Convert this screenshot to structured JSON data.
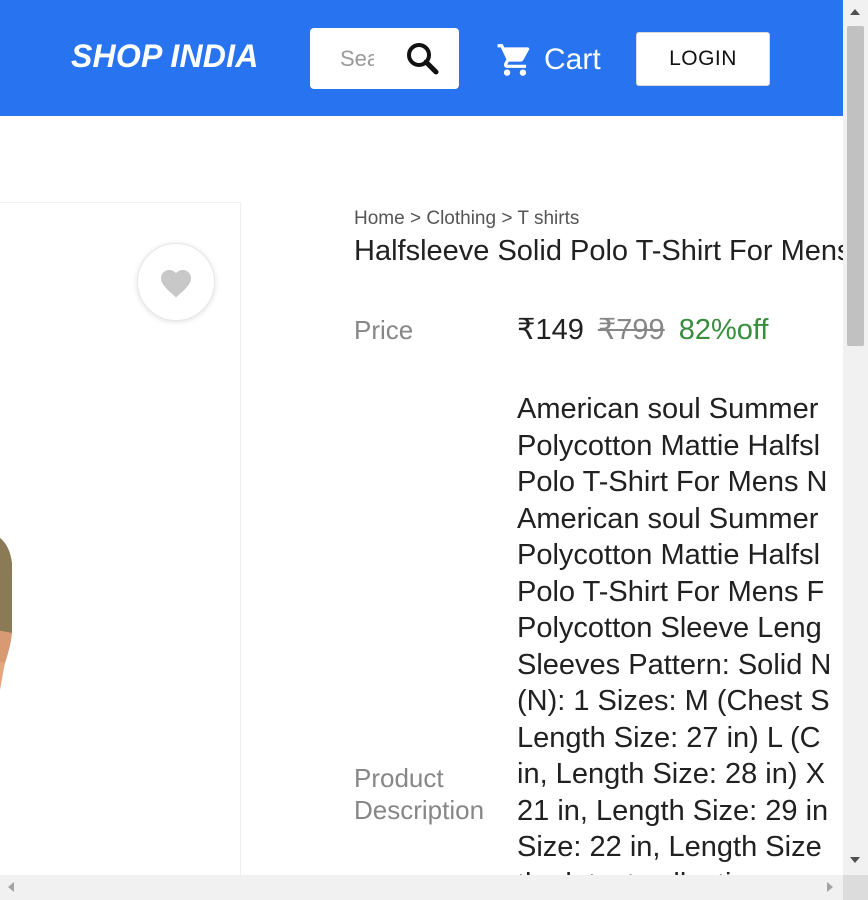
{
  "header": {
    "brand": "SHOP INDIA",
    "search_placeholder": "Search",
    "cart_label": "Cart",
    "login_label": "LOGIN"
  },
  "breadcrumb": {
    "items": [
      "Home",
      "Clothing",
      "T shirts"
    ],
    "separator": ">"
  },
  "product": {
    "title": "Halfsleeve Solid Polo T-Shirt For Mens",
    "price_label": "Price",
    "price": "₹149",
    "mrp": "₹799",
    "discount": "82%off",
    "description_label": "Product Description",
    "description": "American soul Summer\nPolycotton Mattie Halfsl\nPolo T-Shirt For Mens N\nAmerican soul Summer\nPolycotton Mattie Halfsl\nPolo T-Shirt For Mens F\nPolycotton Sleeve Leng\nSleeves Pattern: Solid N\n(N): 1 Sizes: M (Chest S\nLength Size: 27 in) L (C\nin, Length Size: 28 in) X\n21 in, Length Size: 29 in\nSize: 22 in, Length Size\nthe latest collection"
  },
  "icons": {
    "search": "search-icon",
    "cart": "cart-icon",
    "wishlist": "heart-icon"
  },
  "colors": {
    "header_bg": "#2874f0",
    "price_text": "#212121",
    "label_text": "#878787"
  }
}
